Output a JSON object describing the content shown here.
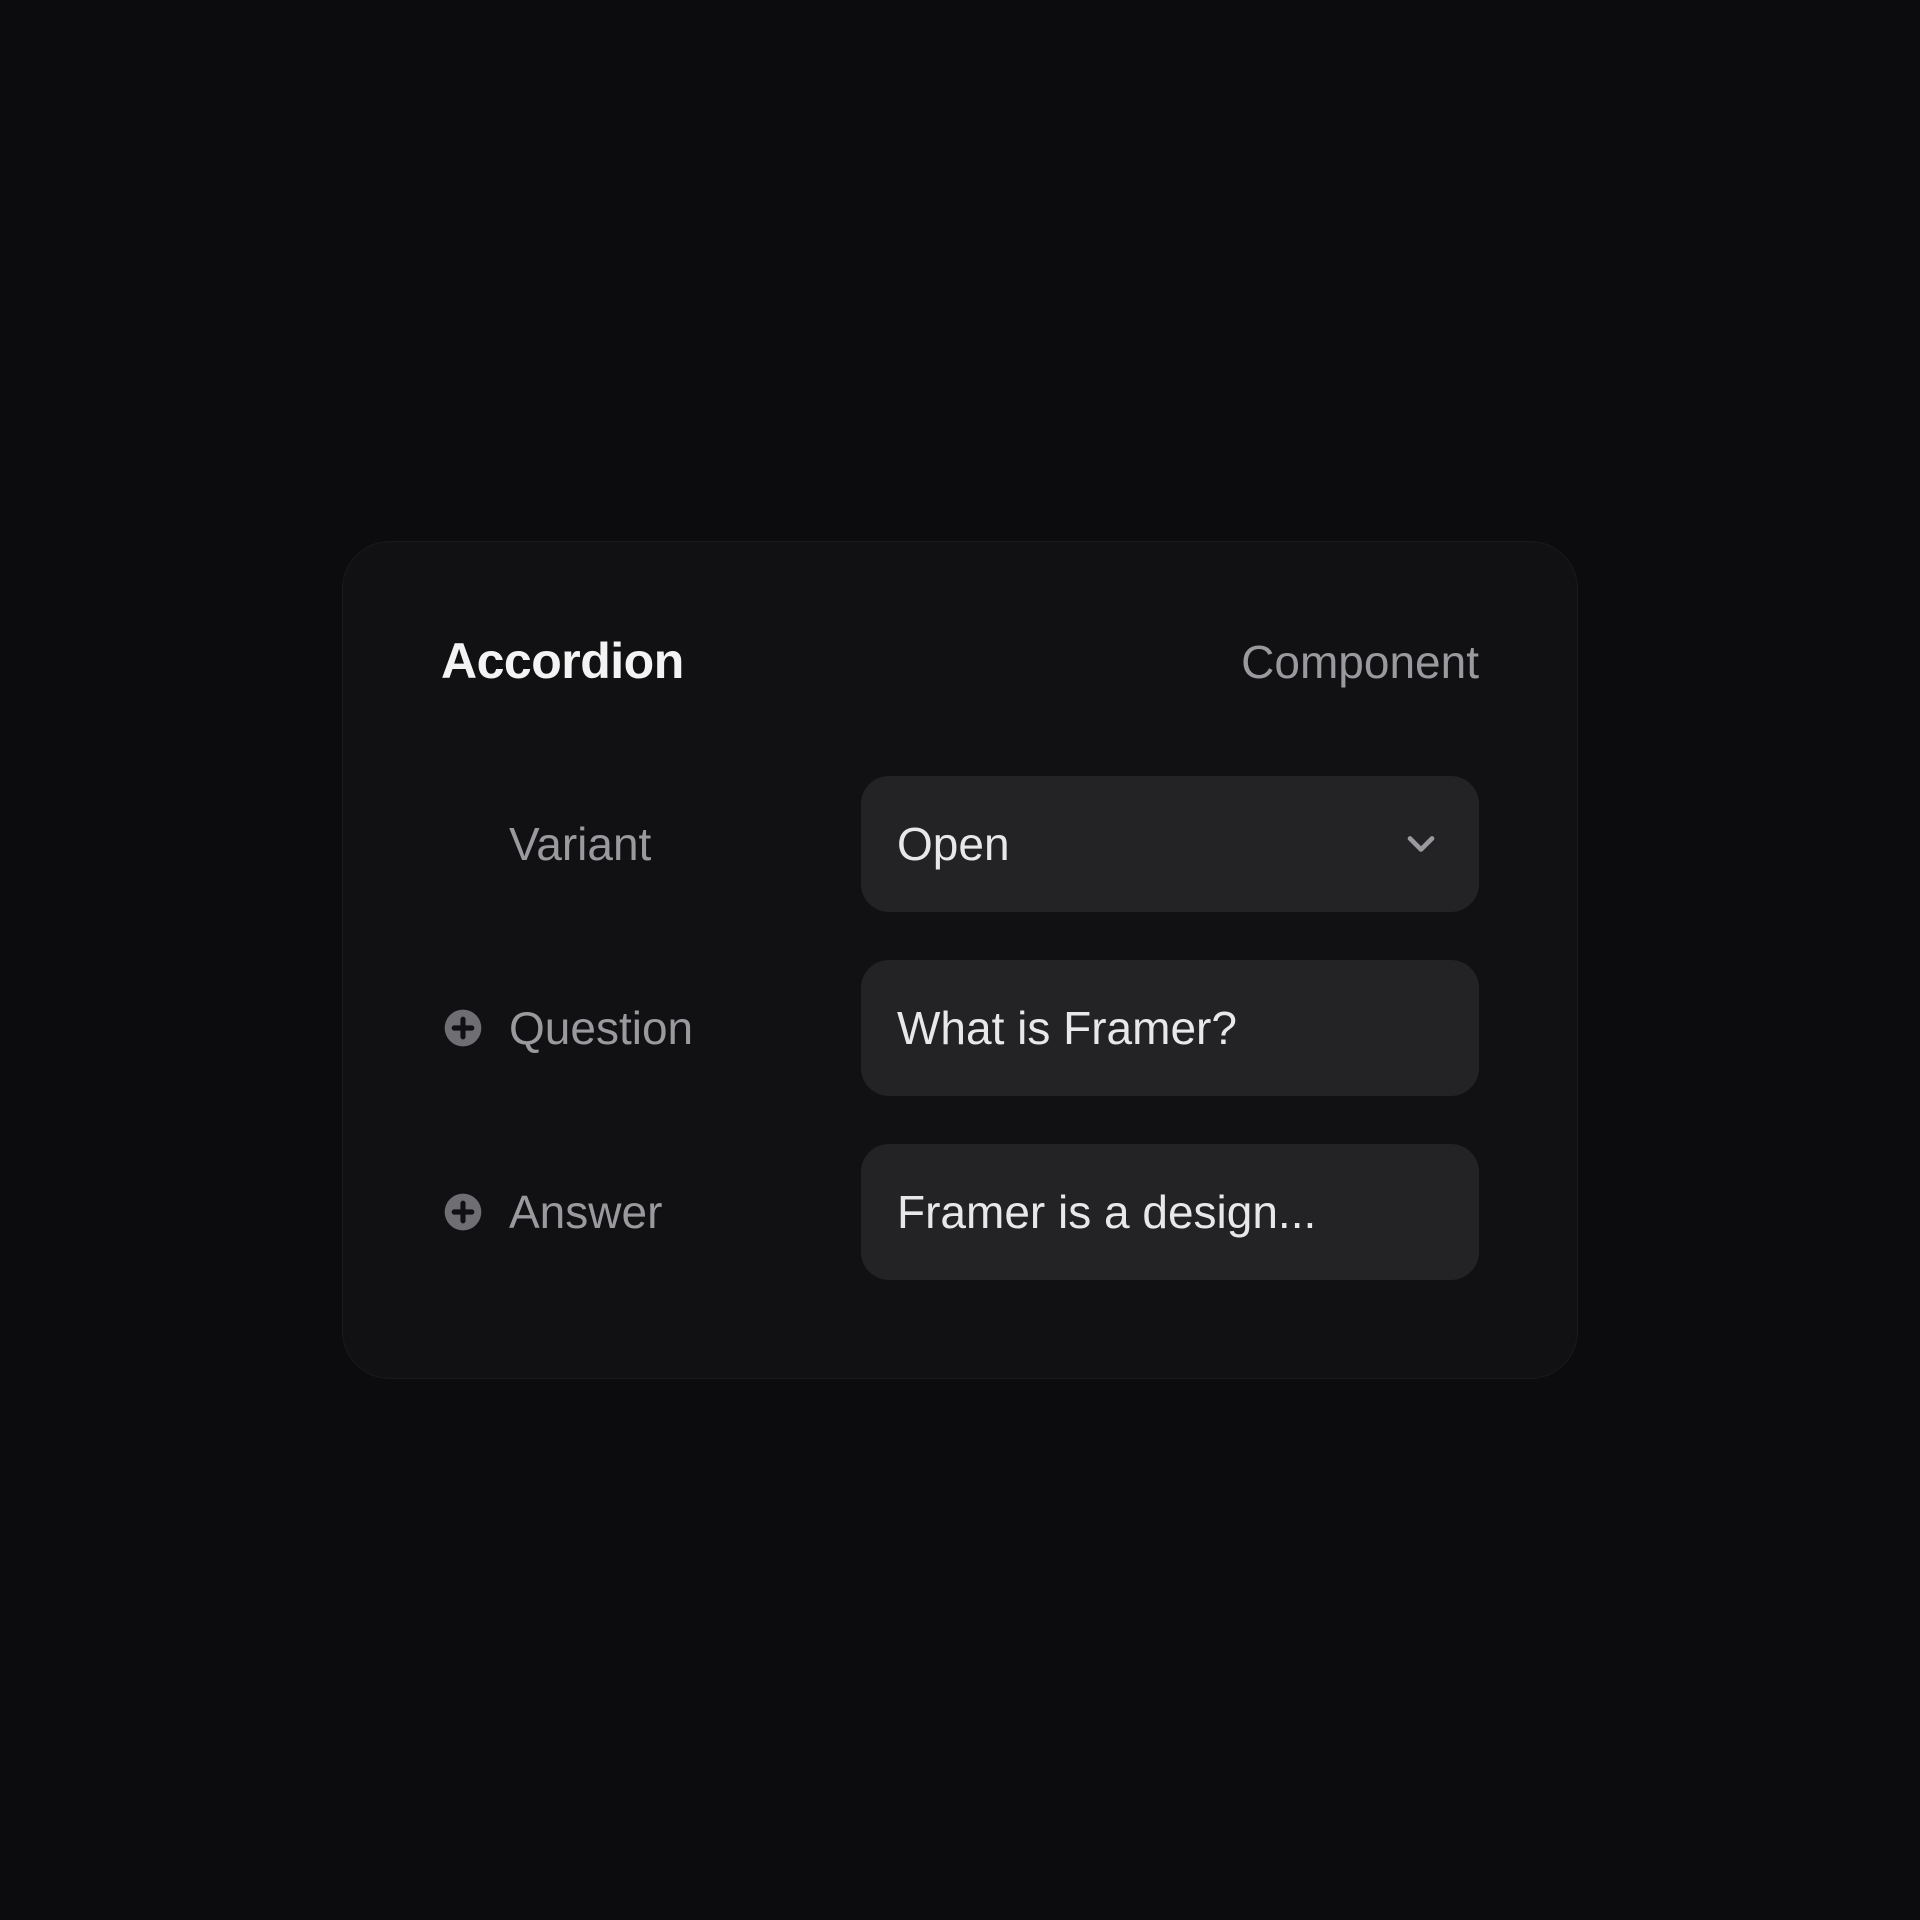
{
  "panel": {
    "title": "Accordion",
    "type": "Component",
    "rows": {
      "variant": {
        "label": "Variant",
        "value": "Open"
      },
      "question": {
        "label": "Question",
        "value": "What is Framer?"
      },
      "answer": {
        "label": "Answer",
        "value": "Framer is a design..."
      }
    }
  },
  "colors": {
    "background": "#0c0c0e",
    "panel": "#111113",
    "field": "#232325",
    "textPrimary": "#f3f3f3",
    "textSecondary": "#9a9a9e",
    "fieldText": "#e8e8ea",
    "iconMuted": "#6f6f73"
  }
}
